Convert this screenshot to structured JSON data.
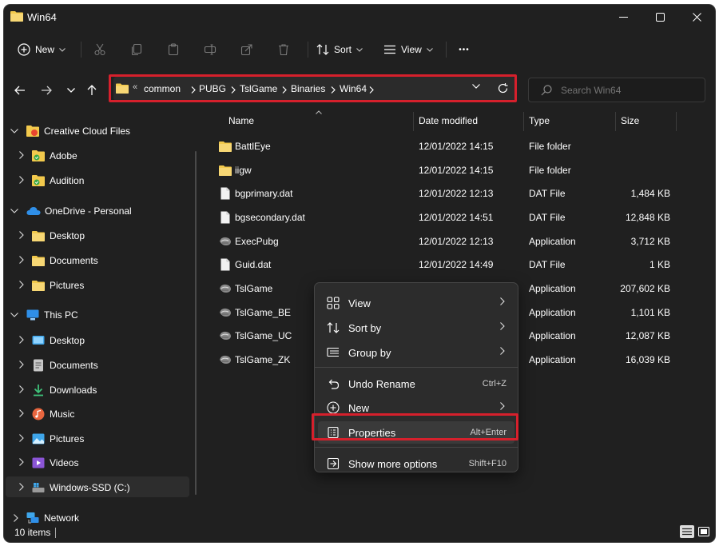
{
  "window": {
    "title": "Win64"
  },
  "toolbar": {
    "new_label": "New",
    "sort_label": "Sort",
    "view_label": "View",
    "more_label": "•••"
  },
  "address": {
    "overflow": "«",
    "crumbs": [
      "common",
      "PUBG",
      "TslGame",
      "Binaries",
      "Win64"
    ]
  },
  "search": {
    "placeholder": "Search Win64"
  },
  "sidebar": {
    "items": [
      {
        "label": "Creative Cloud Files",
        "icon": "creative-cloud-icon"
      },
      {
        "label": "Adobe",
        "icon": "folder-synced-icon"
      },
      {
        "label": "Audition",
        "icon": "folder-synced-icon"
      },
      {
        "label": "OneDrive - Personal",
        "icon": "onedrive-icon"
      },
      {
        "label": "Desktop",
        "icon": "folder-icon"
      },
      {
        "label": "Documents",
        "icon": "folder-icon"
      },
      {
        "label": "Pictures",
        "icon": "folder-icon"
      },
      {
        "label": "This PC",
        "icon": "pc-icon"
      },
      {
        "label": "Desktop",
        "icon": "desktop-icon"
      },
      {
        "label": "Documents",
        "icon": "documents-icon"
      },
      {
        "label": "Downloads",
        "icon": "download-icon"
      },
      {
        "label": "Music",
        "icon": "music-icon"
      },
      {
        "label": "Pictures",
        "icon": "pictures-icon"
      },
      {
        "label": "Videos",
        "icon": "videos-icon"
      },
      {
        "label": "Windows-SSD (C:)",
        "icon": "drive-icon"
      },
      {
        "label": "Network",
        "icon": "network-icon"
      }
    ]
  },
  "columns": {
    "name": "Name",
    "date": "Date modified",
    "type": "Type",
    "size": "Size"
  },
  "files": [
    {
      "name": "BattlEye",
      "date": "12/01/2022 14:15",
      "type": "File folder",
      "size": "",
      "icon": "folder-icon"
    },
    {
      "name": "iigw",
      "date": "12/01/2022 14:15",
      "type": "File folder",
      "size": "",
      "icon": "folder-icon"
    },
    {
      "name": "bgprimary.dat",
      "date": "12/01/2022 12:13",
      "type": "DAT File",
      "size": "1,484 KB",
      "icon": "file-icon"
    },
    {
      "name": "bgsecondary.dat",
      "date": "12/01/2022 14:51",
      "type": "DAT File",
      "size": "12,848 KB",
      "icon": "file-icon"
    },
    {
      "name": "ExecPubg",
      "date": "12/01/2022 12:13",
      "type": "Application",
      "size": "3,712 KB",
      "icon": "app-icon"
    },
    {
      "name": "Guid.dat",
      "date": "12/01/2022 14:49",
      "type": "DAT File",
      "size": "1 KB",
      "icon": "file-icon"
    },
    {
      "name": "TslGame",
      "date": "",
      "type": "Application",
      "size": "207,602 KB",
      "icon": "app-icon"
    },
    {
      "name": "TslGame_BE",
      "date": "",
      "type": "Application",
      "size": "1,101 KB",
      "icon": "app-icon"
    },
    {
      "name": "TslGame_UC",
      "date": "",
      "type": "Application",
      "size": "12,087 KB",
      "icon": "app-icon"
    },
    {
      "name": "TslGame_ZK",
      "date": "",
      "type": "Application",
      "size": "16,039 KB",
      "icon": "app-icon"
    }
  ],
  "context_menu": {
    "items": [
      {
        "label": "View",
        "shortcut": "",
        "icon": "view-grid-icon",
        "submenu": true
      },
      {
        "label": "Sort by",
        "shortcut": "",
        "icon": "sort-icon",
        "submenu": true
      },
      {
        "label": "Group by",
        "shortcut": "",
        "icon": "group-icon",
        "submenu": true
      },
      {
        "label": "Undo Rename",
        "shortcut": "Ctrl+Z",
        "icon": "undo-icon",
        "submenu": false
      },
      {
        "label": "New",
        "shortcut": "",
        "icon": "plus-circle-icon",
        "submenu": true
      },
      {
        "label": "Properties",
        "shortcut": "Alt+Enter",
        "icon": "properties-icon",
        "submenu": false
      },
      {
        "label": "Show more options",
        "shortcut": "Shift+F10",
        "icon": "more-options-icon",
        "submenu": false
      }
    ]
  },
  "status": {
    "count": "10 items"
  },
  "colors": {
    "background": "#202020",
    "highlight": "#d6202c",
    "folder": "#f2c94c",
    "menu": "#2c2c2c"
  }
}
